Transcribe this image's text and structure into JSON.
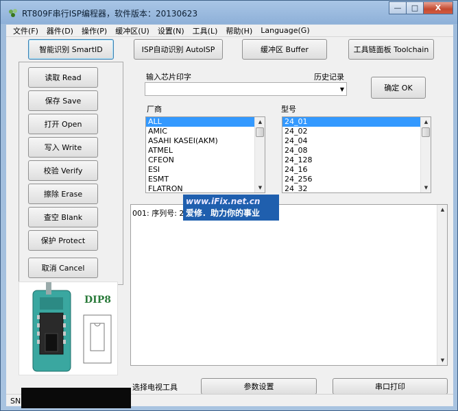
{
  "window": {
    "title": "RT809F串行ISP编程器，软件版本：20130623",
    "min_glyph": "—",
    "max_glyph": "□",
    "close_glyph": "X"
  },
  "menu": [
    "文件(F)",
    "器件(D)",
    "操作(P)",
    "缓冲区(U)",
    "设置(N)",
    "工具(L)",
    "帮助(H)",
    "Language(G)"
  ],
  "toolbar": {
    "smartid": "智能识别 SmartID",
    "autoisp": "ISP自动识别 AutoISP",
    "buffer": "缓冲区 Buffer",
    "toolchain": "工具链面板 Toolchain"
  },
  "actions": {
    "read": "读取 Read",
    "save": "保存 Save",
    "open": "打开 Open",
    "write": "写入 Write",
    "verify": "校验 Verify",
    "erase": "擦除 Erase",
    "blank": "查空 Blank",
    "protect": "保护 Protect",
    "cancel": "取消 Cancel"
  },
  "chip_input": {
    "label": "输入芯片印字",
    "history_label": "历史记录",
    "value": "",
    "ok_button": "确定 OK"
  },
  "manufacturer": {
    "label": "厂商",
    "items": [
      "ALL",
      "AMIC",
      "ASAHI KASEI(AKM)",
      "ATMEL",
      "CFEON",
      "ESI",
      "ESMT",
      "FLATRON"
    ],
    "selected": "ALL"
  },
  "model": {
    "label": "型号",
    "items": [
      "24_01",
      "24_02",
      "24_04",
      "24_08",
      "24_128",
      "24_16",
      "24_256",
      "24_32"
    ],
    "selected": "24_01"
  },
  "log": {
    "line1": "001: 序列号: 2"
  },
  "watermark": {
    "line1": "www.iFix.net.cn",
    "line2": "爱修．助力你的事业"
  },
  "dip": {
    "label": "DIP8"
  },
  "bottom": {
    "tv_tools": "选择电视工具",
    "params_button": "参数设置",
    "serial_print_button": "串口打印"
  },
  "status": {
    "text": "SN"
  },
  "colors": {
    "selection": "#3399ff",
    "watermark_bg": "#1f5fae",
    "board": "#3aa7a0"
  }
}
